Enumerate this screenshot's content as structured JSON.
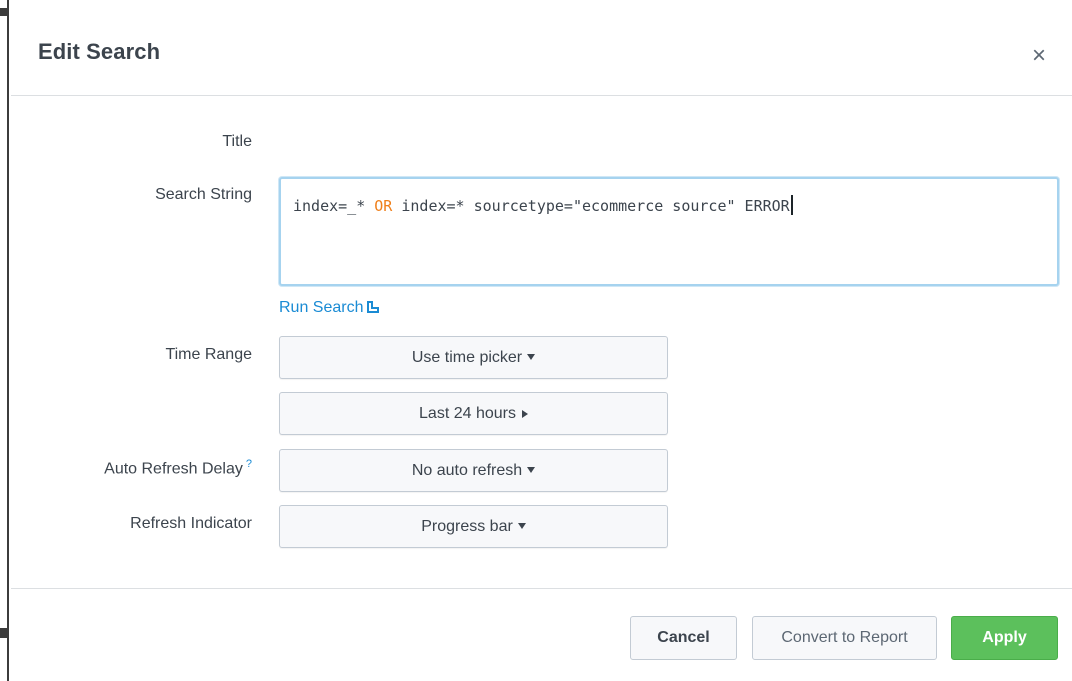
{
  "dialog": {
    "title": "Edit Search",
    "close_symbol": "×"
  },
  "form": {
    "title_label": "Title",
    "search_string_label": "Search String",
    "search_string": {
      "part1": "index=_* ",
      "keyword": "OR",
      "part2": " index=* sourcetype=\"ecommerce source\" ERROR"
    },
    "run_search_label": "Run Search",
    "time_range_label": "Time Range",
    "time_picker_button": "Use time picker",
    "time_range_value": "Last 24 hours",
    "auto_refresh_label": "Auto Refresh Delay",
    "auto_refresh_help": "?",
    "auto_refresh_value": "No auto refresh",
    "refresh_indicator_label": "Refresh Indicator",
    "refresh_indicator_value": "Progress bar"
  },
  "footer": {
    "cancel_label": "Cancel",
    "convert_label": "Convert to Report",
    "apply_label": "Apply"
  },
  "colors": {
    "link": "#1a8bd4",
    "keyword_or": "#ef7f1a",
    "apply_green": "#5cc05c",
    "focus_border": "#a6d3ef"
  },
  "icons": {
    "close": "close-icon",
    "external_link": "external-link-icon",
    "dropdown": "chevron-down-icon",
    "submenu": "chevron-right-icon"
  }
}
